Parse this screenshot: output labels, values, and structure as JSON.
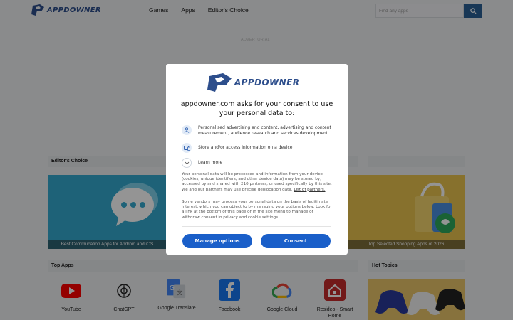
{
  "header": {
    "logo_text": "APPDOWNER",
    "nav": [
      "Games",
      "Apps",
      "Editor's Choice"
    ],
    "search_placeholder": "Find any apps"
  },
  "advertorial": "ADVERTORIAL",
  "editors_choice": {
    "title": "Editor's Choice",
    "cards": [
      {
        "caption": "Best Commucation Apps for Android and iOS"
      },
      {
        "caption": "Top Selected Shopping Apps of 2026"
      }
    ]
  },
  "top_apps": {
    "title": "Top Apps",
    "apps": [
      {
        "name": "YouTube",
        "icon": "youtube-icon"
      },
      {
        "name": "ChatGPT",
        "icon": "chatgpt-icon"
      },
      {
        "name": "Google Translate",
        "icon": "google-translate-icon"
      },
      {
        "name": "Facebook",
        "icon": "facebook-icon"
      },
      {
        "name": "Google Cloud",
        "icon": "google-cloud-icon"
      },
      {
        "name": "Resideo - Smart Home",
        "icon": "resideo-icon"
      }
    ]
  },
  "hot_topics": {
    "title": "Hot Topics"
  },
  "consent": {
    "logo_text": "APPDOWNER",
    "title": "appdowner.com asks for your consent to use your personal data to:",
    "purposes": [
      {
        "icon": "person-icon",
        "text": "Personalised advertising and content, advertising and content measurement, audience research and services development"
      },
      {
        "icon": "device-icon",
        "text": "Store and/or access information on a device"
      },
      {
        "icon": "chevron-down-icon",
        "text": "Learn more"
      }
    ],
    "para1": "Your personal data will be processed and information from your device (cookies, unique identifiers, and other device data) may be stored by, accessed by and shared with 210 partners, or used specifically by this site. We and our partners may use precise geolocation data.",
    "para1_link": "List of partners.",
    "para2": "Some vendors may process your personal data on the basis of legitimate interest, which you can object to by managing your options below. Look for a link at the bottom of this page or in the site menu to manage or withdraw consent in privacy and cookie settings.",
    "manage_label": "Manage options",
    "consent_label": "Consent"
  },
  "colors": {
    "brand": "#2d4e8c",
    "button": "#1a5fc9",
    "search_button": "#2a5f94"
  }
}
